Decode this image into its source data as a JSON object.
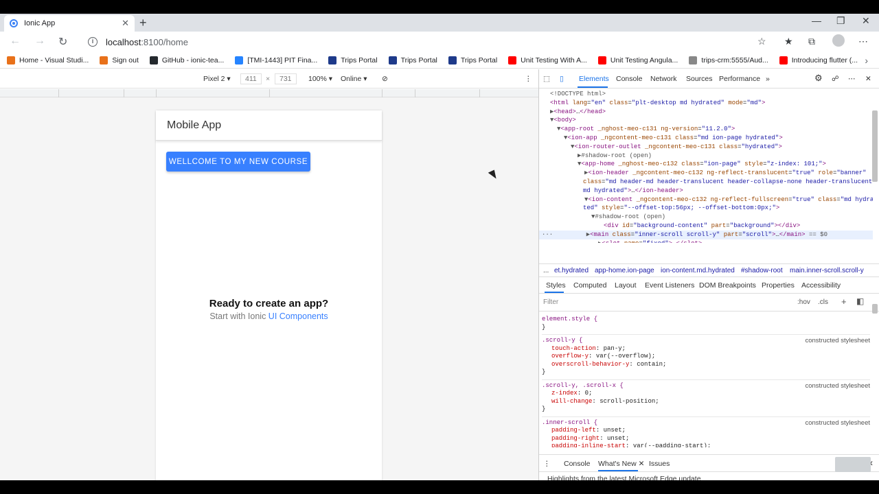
{
  "browser": {
    "tab_title": "Ionic App",
    "tab_close": "✕",
    "new_tab": "+",
    "url_host": "localhost",
    "url_path": ":8100/home",
    "window_controls": [
      "—",
      "❐",
      "✕"
    ]
  },
  "bookmarks": [
    {
      "label": "Home - Visual Studi...",
      "color": "#e8711a"
    },
    {
      "label": "Sign out",
      "color": "#e8711a"
    },
    {
      "label": "GitHub - ionic-tea...",
      "color": "#24292e"
    },
    {
      "label": "[TMI-1443] PIT Fina...",
      "color": "#2684ff"
    },
    {
      "label": "Trips Portal",
      "color": "#1e3a8a"
    },
    {
      "label": "Trips Portal",
      "color": "#1e3a8a"
    },
    {
      "label": "Trips Portal",
      "color": "#1e3a8a"
    },
    {
      "label": "Unit Testing With A...",
      "color": "#ff0000"
    },
    {
      "label": "Unit Testing Angula...",
      "color": "#ff0000"
    },
    {
      "label": "trips-crm:5555/Aud...",
      "color": "#888888"
    },
    {
      "label": "Introducing flutter (...",
      "color": "#ff0000"
    }
  ],
  "emulation": {
    "device": "Pixel 2 ▾",
    "width": "411",
    "times": "×",
    "height": "731",
    "zoom": "100% ▾",
    "network": "Online ▾"
  },
  "app": {
    "header_title": "Mobile App",
    "welcome_button": "WELLCOME TO MY NEW COURSE",
    "ready_title": "Ready to create an app?",
    "ready_text": "Start with Ionic ",
    "ready_link": "UI Components"
  },
  "devtools": {
    "tabs": [
      "Elements",
      "Console",
      "Network",
      "Sources",
      "Performance",
      "»"
    ],
    "breadcrumbs": [
      "...",
      "et.hydrated",
      "app-home.ion-page",
      "ion-content.md.hydrated",
      "#shadow-root",
      "main.inner-scroll.scroll-y"
    ],
    "style_tabs": [
      "Styles",
      "Computed",
      "Layout",
      "Event Listeners",
      "DOM Breakpoints",
      "Properties",
      "Accessibility"
    ],
    "filter_placeholder": "Filter",
    "filter_hov": ":hov",
    "filter_cls": ".cls",
    "filter_plus": "+",
    "drawer_more": "⋮",
    "drawer_tabs": [
      "Console",
      "What's New ✕",
      "Issues"
    ],
    "drawer_text": "Highlights from the latest Microsoft Edge update",
    "styles": [
      {
        "selector": "element.style {",
        "source": "",
        "props": [],
        "close": "}"
      },
      {
        "selector": ".scroll-y {",
        "source": "constructed stylesheet",
        "props": [
          [
            "touch-action",
            "pan-y;"
          ],
          [
            "overflow-y",
            "var(--overflow);"
          ],
          [
            "overscroll-behavior-y",
            "contain;"
          ]
        ],
        "close": "}"
      },
      {
        "selector": ".scroll-y, .scroll-x {",
        "source": "constructed stylesheet",
        "props": [
          [
            "z-index",
            "0;"
          ],
          [
            "will-change",
            "scroll-position;"
          ]
        ],
        "close": "}"
      },
      {
        "selector": ".inner-scroll {",
        "source": "constructed stylesheet",
        "props": [
          [
            "padding-left",
            "unset;"
          ],
          [
            "padding-right",
            "unset;"
          ],
          [
            "padding-inline-start",
            "var(--padding-start);"
          ]
        ],
        "close": ""
      }
    ]
  }
}
